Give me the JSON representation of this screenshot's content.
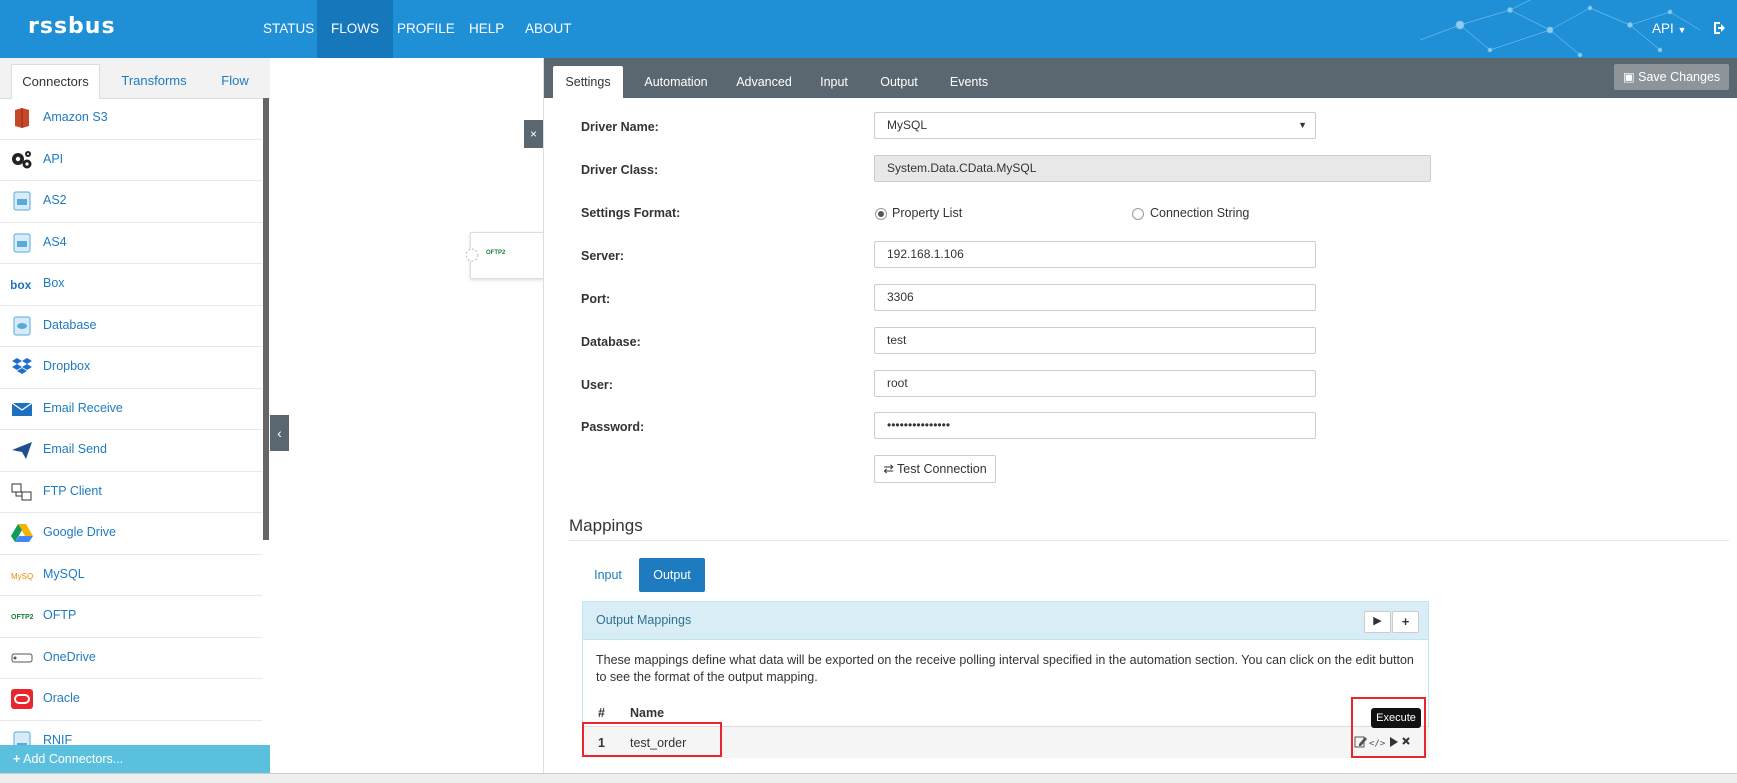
{
  "app": {
    "logo": "rssbus",
    "nav": [
      "STATUS",
      "FLOWS",
      "PROFILE",
      "HELP",
      "ABOUT"
    ],
    "active_nav": "FLOWS",
    "user_menu": "API"
  },
  "left": {
    "tabs": [
      "Connectors",
      "Transforms",
      "Flow"
    ],
    "active_tab": "Connectors",
    "connectors": [
      {
        "label": "Amazon S3",
        "icon": "amazon-s3-icon"
      },
      {
        "label": "API",
        "icon": "gears-icon"
      },
      {
        "label": "AS2",
        "icon": "as2-icon"
      },
      {
        "label": "AS4",
        "icon": "as4-icon"
      },
      {
        "label": "Box",
        "icon": "box-icon"
      },
      {
        "label": "Database",
        "icon": "database-icon"
      },
      {
        "label": "Dropbox",
        "icon": "dropbox-icon"
      },
      {
        "label": "Email Receive",
        "icon": "envelope-icon"
      },
      {
        "label": "Email Send",
        "icon": "paper-plane-icon"
      },
      {
        "label": "FTP Client",
        "icon": "ftp-icon"
      },
      {
        "label": "Google Drive",
        "icon": "google-drive-icon"
      },
      {
        "label": "MySQL",
        "icon": "mysql-icon"
      },
      {
        "label": "OFTP",
        "icon": "oftp-icon"
      },
      {
        "label": "OneDrive",
        "icon": "onedrive-icon"
      },
      {
        "label": "Oracle",
        "icon": "oracle-icon"
      },
      {
        "label": "RNIF",
        "icon": "rnif-icon"
      }
    ],
    "add_connectors": "Add Connectors..."
  },
  "canvas": {
    "close_label": "×",
    "collapse_label": "‹",
    "node_label": "OFTP2"
  },
  "settings": {
    "tabs": [
      "Settings",
      "Automation",
      "Advanced",
      "Input",
      "Output",
      "Events"
    ],
    "active_tab": "Settings",
    "save_label": "Save Changes",
    "driver_name_label": "Driver Name:",
    "driver_name_value": "MySQL",
    "driver_class_label": "Driver Class:",
    "driver_class_value": "System.Data.CData.MySQL",
    "settings_format_label": "Settings Format:",
    "format_property_list": "Property List",
    "format_connection_string": "Connection String",
    "selected_format": "Property List",
    "server_label": "Server:",
    "server_value": "192.168.1.106",
    "port_label": "Port:",
    "port_value": "3306",
    "database_label": "Database:",
    "database_value": "test",
    "user_label": "User:",
    "user_value": "root",
    "password_label": "Password:",
    "password_value": "•••••••••••••••",
    "test_connection_label": "Test Connection"
  },
  "mappings": {
    "title": "Mappings",
    "tabs": [
      "Input",
      "Output"
    ],
    "active_tab": "Output",
    "panel_title": "Output Mappings",
    "description": "These mappings define what data will be exported on the receive polling interval specified in the automation section. You can click on the edit button to see the format of the output mapping.",
    "columns": [
      "#",
      "Name"
    ],
    "rows": [
      {
        "num": "1",
        "name": "test_order"
      }
    ],
    "tooltip": "Execute"
  },
  "colors": {
    "topbar": "#1f8fd6",
    "link": "#1f7bc0",
    "settings_bar": "#5b6770",
    "highlight": "#e8262b"
  }
}
